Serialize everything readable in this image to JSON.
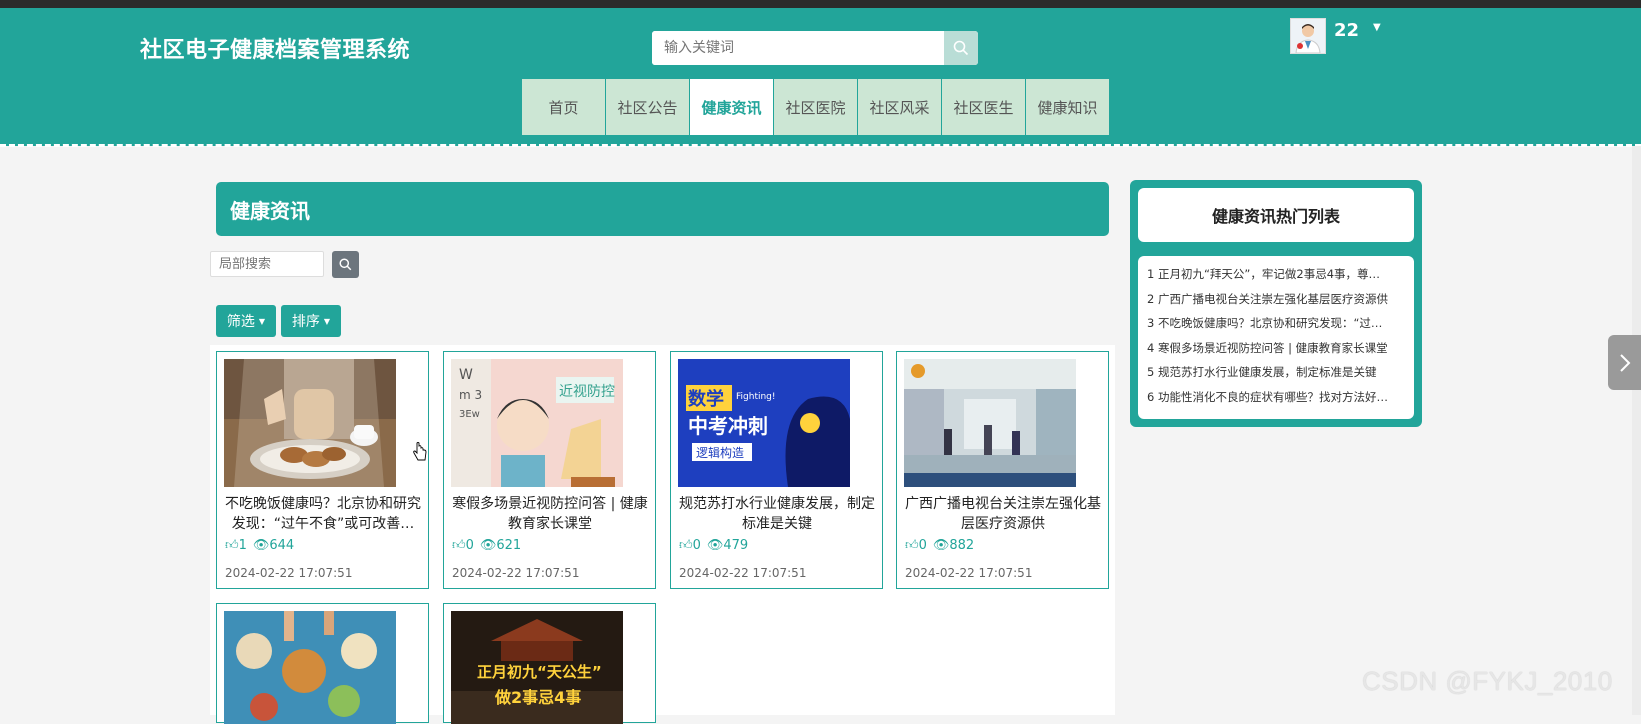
{
  "header": {
    "site_title": "社区电子健康档案管理系统",
    "search_placeholder": "输入关键词",
    "user_name": "22"
  },
  "nav": [
    {
      "label": "首页",
      "active": false
    },
    {
      "label": "社区公告",
      "active": false
    },
    {
      "label": "健康资讯",
      "active": true
    },
    {
      "label": "社区医院",
      "active": false
    },
    {
      "label": "社区风采",
      "active": false
    },
    {
      "label": "社区医生",
      "active": false
    },
    {
      "label": "健康知识",
      "active": false
    }
  ],
  "main": {
    "section_title": "健康资讯",
    "local_search_placeholder": "局部搜索",
    "filter_label": "筛选",
    "sort_label": "排序"
  },
  "cards": [
    {
      "title": "不吃晚饭健康吗？北京协和研究发现：“过午不食”或可改善…",
      "likes": "1",
      "views": "644",
      "date": "2024-02-22 17:07:51"
    },
    {
      "title": "寒假多场景近视防控问答 | 健康教育家长课堂",
      "likes": "0",
      "views": "621",
      "date": "2024-02-22 17:07:51"
    },
    {
      "title": "规范苏打水行业健康发展，制定标准是关键",
      "likes": "0",
      "views": "479",
      "date": "2024-02-22 17:07:51"
    },
    {
      "title": "广西广播电视台关注崇左强化基层医疗资源供",
      "likes": "0",
      "views": "882",
      "date": "2024-02-22 17:07:51"
    }
  ],
  "card_images": {
    "card3_text1": "数学",
    "card3_text2": "中考冲刺",
    "card3_text3": "逻辑构造",
    "card3_text4": "Fighting!",
    "card2_text": "近视防控",
    "card6_text1": "正月初九“天公生”",
    "card6_text2": "做2事忌4事"
  },
  "hot": {
    "title": "健康资讯热门列表",
    "items": [
      "1  正月初九“拜天公”，牢记做2事忌4事，尊…",
      "2  广西广播电视台关注崇左强化基层医疗资源供",
      "3  不吃晚饭健康吗？北京协和研究发现：“过…",
      "4  寒假多场景近视防控问答 | 健康教育家长课堂",
      "5  规范苏打水行业健康发展，制定标准是关键",
      "6  功能性消化不良的症状有哪些？找对方法好…"
    ]
  },
  "watermark": "CSDN @FYKJ_2010",
  "colors": {
    "primary": "#22a59a",
    "nav_bg": "#cce6d4"
  }
}
